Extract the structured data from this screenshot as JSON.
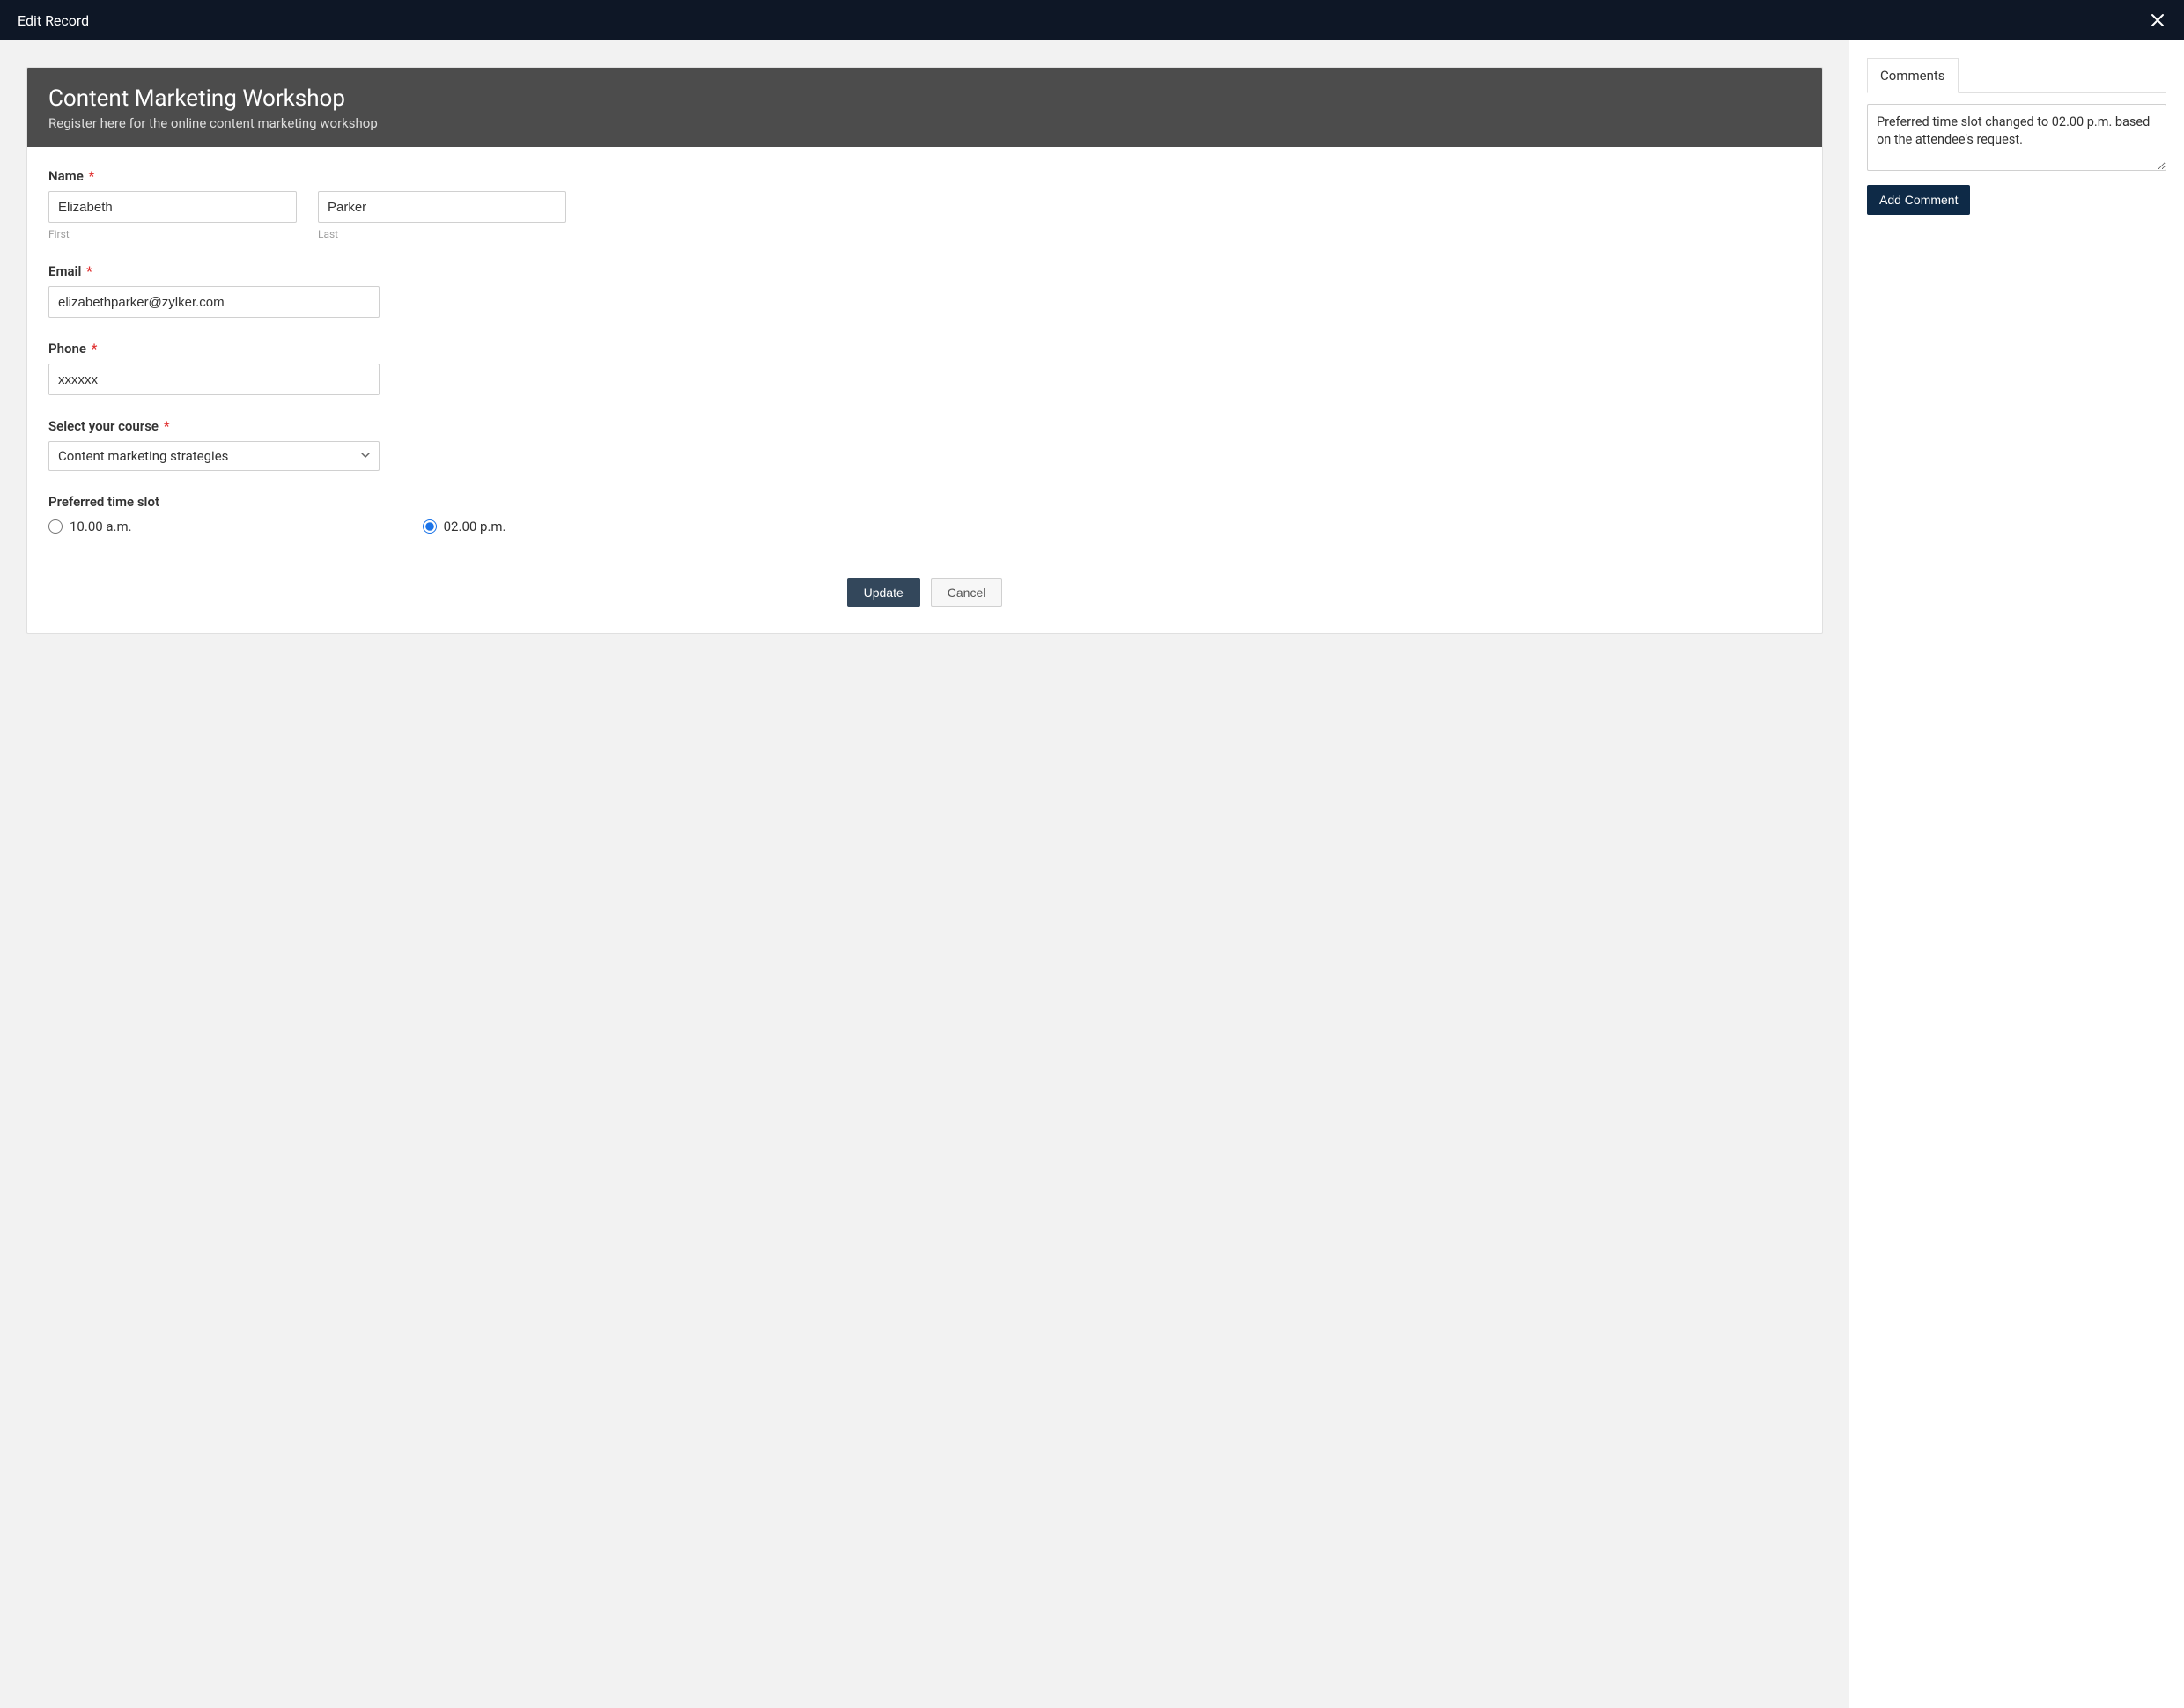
{
  "topbar": {
    "title": "Edit Record"
  },
  "form": {
    "title": "Content Marketing Workshop",
    "subtitle": "Register here for the online content marketing workshop",
    "name": {
      "label": "Name",
      "first_value": "Elizabeth",
      "last_value": "Parker",
      "first_sub": "First",
      "last_sub": "Last"
    },
    "email": {
      "label": "Email",
      "value": "elizabethparker@zylker.com"
    },
    "phone": {
      "label": "Phone",
      "value": "xxxxxx"
    },
    "course": {
      "label": "Select your course",
      "value": "Content marketing strategies"
    },
    "timeslot": {
      "label": "Preferred time slot",
      "option1": "10.00 a.m.",
      "option2": "02.00 p.m.",
      "selected": "02.00 p.m."
    },
    "buttons": {
      "update": "Update",
      "cancel": "Cancel"
    }
  },
  "sidebar": {
    "tab_label": "Comments",
    "comment_value": "Preferred time slot changed to 02.00 p.m. based on the attendee's request.",
    "add_button": "Add Comment"
  }
}
